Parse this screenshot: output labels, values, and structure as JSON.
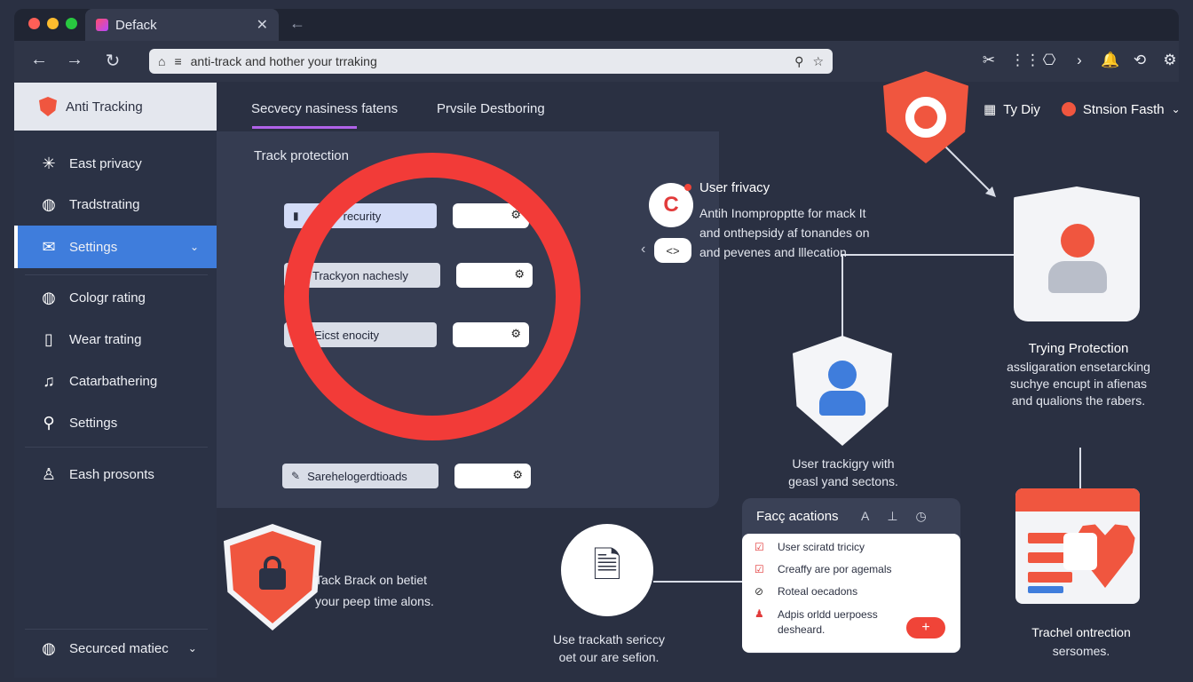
{
  "browser": {
    "tab_title": "Defack",
    "tab_close": "✕",
    "tab_back": "←",
    "url": "anti-track and hother your trraking",
    "nav": {
      "back": "←",
      "forward": "→",
      "reload": "↻"
    },
    "url_icons": {
      "home": "⌂",
      "menu": "≡",
      "share": "⚲",
      "star": "☆"
    },
    "toolbar_icons": [
      "scissors-icon",
      "grid-icon",
      "bag-icon",
      "chevron-right-icon",
      "bell-icon",
      "sync-icon",
      "gear-icon"
    ],
    "toolbar_glyphs": [
      "✂",
      "⋮⋮",
      "⎔",
      "›",
      "🔔",
      "⟲",
      "⚙"
    ]
  },
  "sidebar": {
    "header": "Anti Tracking",
    "items": [
      {
        "label": "East privacy",
        "icon": "sparkle-icon",
        "glyph": "✳"
      },
      {
        "label": "Tradstrating",
        "icon": "globe-icon",
        "glyph": "◍"
      },
      {
        "label": "Settings",
        "icon": "envelope-icon",
        "glyph": "✉",
        "active": true,
        "chev": "⌄"
      },
      {
        "label": "Cologr rating",
        "icon": "globe-icon",
        "glyph": "◍"
      },
      {
        "label": "Wear trating",
        "icon": "phone-icon",
        "glyph": "▯"
      },
      {
        "label": "Catarbathering",
        "icon": "bell-icon",
        "glyph": "♫"
      },
      {
        "label": "Settings",
        "icon": "magnifier-icon",
        "glyph": "⚲"
      },
      {
        "label": "Eash prosonts",
        "icon": "person-icon",
        "glyph": "♙"
      }
    ],
    "footer": {
      "label": "Securced matiec",
      "glyph": "◍",
      "chev": "⌄"
    }
  },
  "main": {
    "tabs": [
      "Secvecy nasiness fatens",
      "Prvsile Destboring"
    ],
    "panel_title": "Track protection",
    "fields": [
      {
        "label": "recurity",
        "icon": "▮",
        "toggle": "⚙"
      },
      {
        "label": "Trackyon nachesly",
        "icon": "",
        "toggle": "⚙"
      },
      {
        "label": "Eicst enocity",
        "icon": "",
        "toggle": "⚙"
      },
      {
        "label": "Sarehelogerdtioads",
        "icon": "✎",
        "toggle": "⚙"
      }
    ]
  },
  "privacy": {
    "logo": "C",
    "title": "User frivacy",
    "lines": [
      "Antih Inompropptte for mack It",
      "and onthepsidy af tonandes on",
      "and pevenes and lllecation"
    ],
    "pill": "<>",
    "pill_arrow": "‹"
  },
  "header_right": {
    "square": "▦",
    "left": "Ty Diy",
    "right": "Stnsion Fasth",
    "chev": "⌄"
  },
  "trying": {
    "title": "Trying Protection",
    "lines": [
      "assligaration ensetarcking",
      "suchye encupt in afienas",
      "and qualions the rabers."
    ]
  },
  "usertrack": {
    "lines": [
      "User trackigry with",
      "geasl yand sectons."
    ]
  },
  "faq": {
    "title": "Facç acations",
    "icons": [
      "A",
      "⊥",
      "◷"
    ],
    "items": [
      {
        "glyph": "☑",
        "text": "User sciratd tricicy"
      },
      {
        "glyph": "☑",
        "text": "Creaffy are por agemals"
      },
      {
        "glyph": "⊘",
        "text": "Roteal oecadons"
      },
      {
        "glyph": "♟",
        "text": "Adpis orldd uerpoess",
        "text2": "desheard."
      }
    ],
    "add": "+"
  },
  "doc": {
    "glyph": "🗎",
    "lines": [
      "Use trackath sericcy",
      "oet our are sefion."
    ]
  },
  "track": {
    "lines": [
      "Tack Brack on betiet",
      "your peep time alons."
    ]
  },
  "tracher": {
    "title": "Trachel ontrection",
    "sub": "sersomes."
  },
  "colors": {
    "accent": "#3f7ddc",
    "danger": "#f0563f",
    "ring": "#f23b38",
    "bg": "#2a3042"
  }
}
